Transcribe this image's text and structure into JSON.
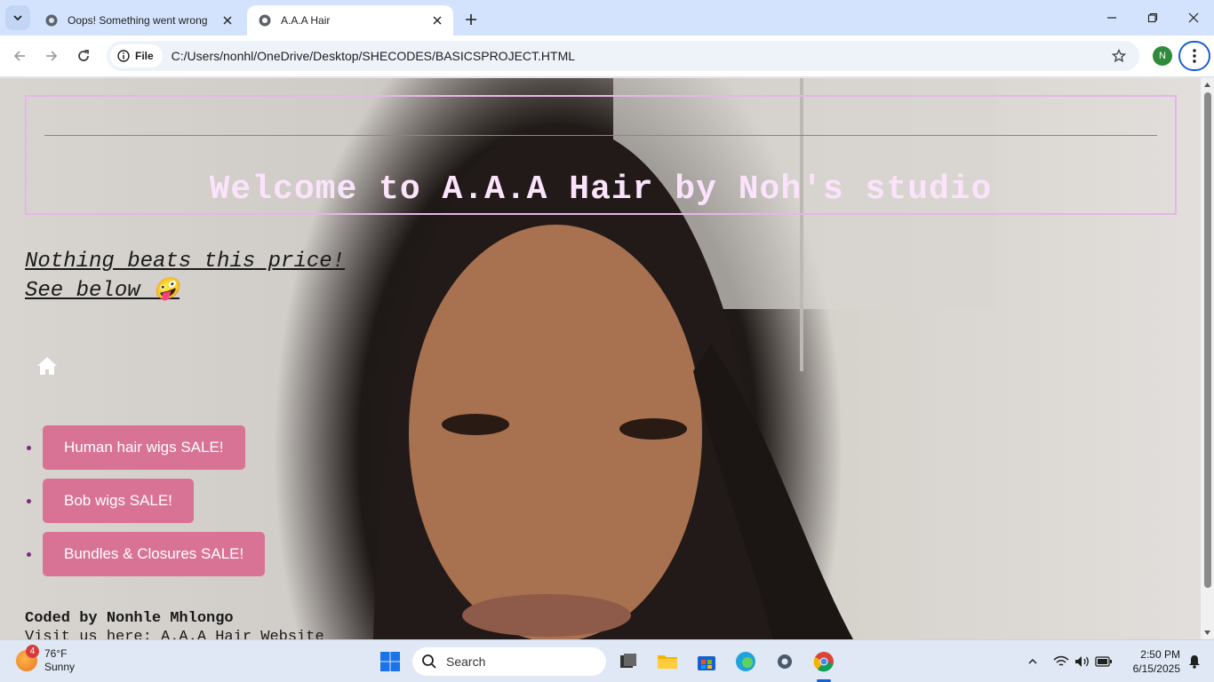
{
  "browser": {
    "tabs": [
      {
        "title": "Oops! Something went wrong",
        "active": false
      },
      {
        "title": "A.A.A Hair",
        "active": true
      }
    ],
    "address": {
      "scheme_chip": "File",
      "url": "C:/Users/nonhl/OneDrive/Desktop/SHECODES/BASICSPROJECT.HTML"
    },
    "profile_initial": "N"
  },
  "page": {
    "title": "Welcome to A.A.A Hair by Noh's studio",
    "tagline_line1": "Nothing beats this price!",
    "tagline_line2": "See below 🤪",
    "sale_buttons": [
      {
        "label": "Human hair wigs SALE!"
      },
      {
        "label": "Bob wigs SALE!"
      },
      {
        "label": "Bundles & Closures SALE!"
      }
    ],
    "footer_credit": "Coded by Nonhle Mhlongo",
    "footer_link": "Visit us here: A.A.A Hair Website",
    "colors": {
      "header_border": "#e6b6e8",
      "title": "#fbe3fb",
      "button": "#d97396"
    }
  },
  "taskbar": {
    "weather": {
      "temp": "76°F",
      "condition": "Sunny",
      "badge": "4"
    },
    "search_placeholder": "Search",
    "time": "2:50 PM",
    "date": "6/15/2025"
  }
}
